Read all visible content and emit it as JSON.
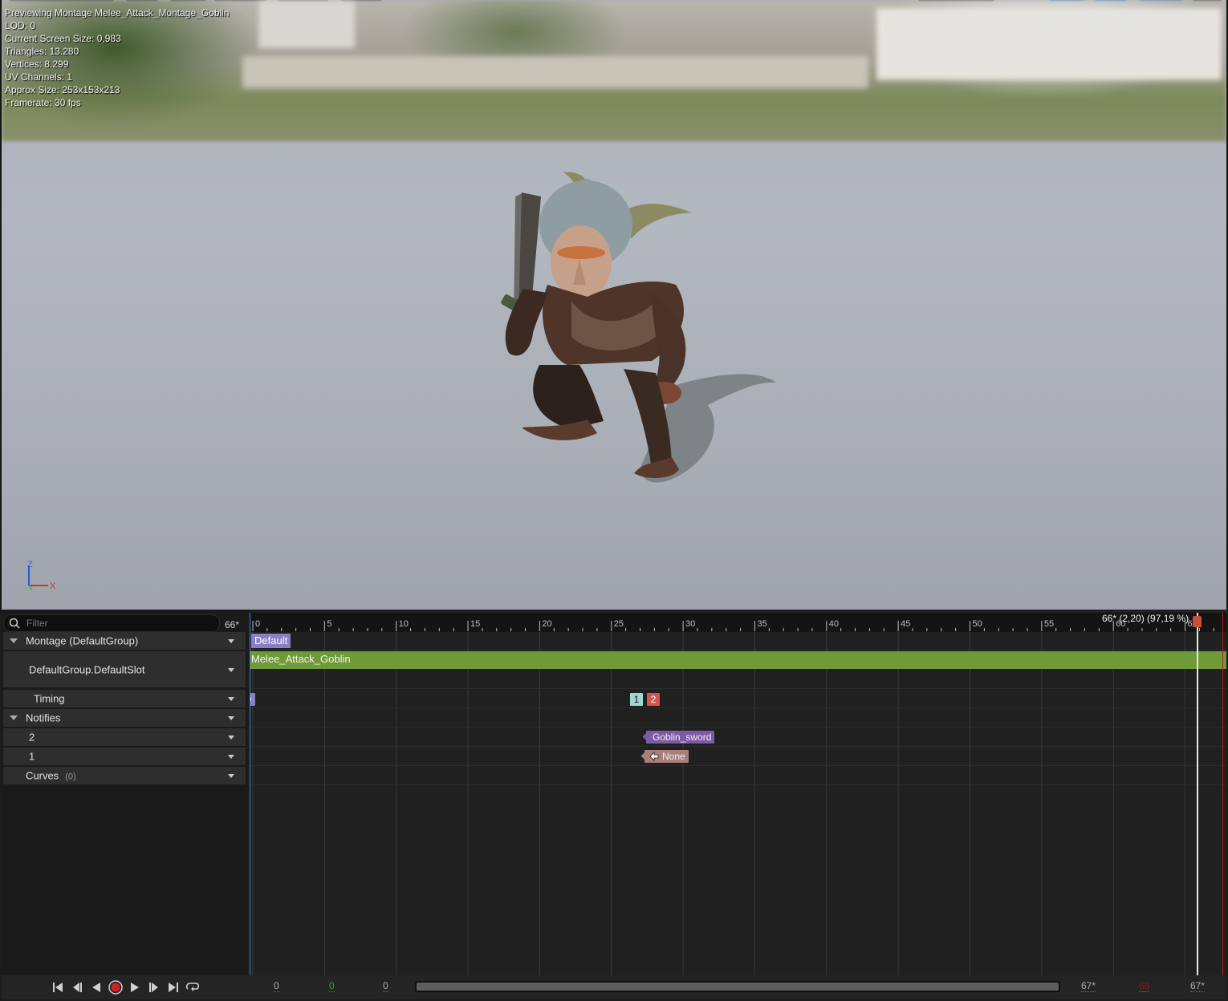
{
  "viewport": {
    "stats": [
      "Previewing Montage Melee_Attack_Montage_Goblin",
      "LOD: 0",
      "Current Screen Size: 0,983",
      "Triangles: 13.280",
      "Vertices: 8.299",
      "UV Channels: 1",
      "Approx Size: 253x153x213",
      "Framerate: 30 fps"
    ],
    "axis": {
      "z": "Z",
      "x": "X"
    }
  },
  "tree": {
    "filter_placeholder": "Filter",
    "frame_count": "66*",
    "rows": {
      "montage": "Montage (DefaultGroup)",
      "slot": "DefaultGroup.DefaultSlot",
      "timing": "Timing",
      "notifies": "Notifies",
      "notify_track_2": "2",
      "notify_track_1": "1",
      "curves": "Curves",
      "curves_count": "(0)"
    }
  },
  "timeline": {
    "ruler_labels": [
      "0",
      "5",
      "10",
      "15",
      "20",
      "25",
      "30",
      "35",
      "40",
      "45",
      "50",
      "55",
      "60",
      "65"
    ],
    "playhead_readout": "66* (2,20) (97,19 %)",
    "section_label": "Default",
    "segment_label": "Melee_Attack_Goblin",
    "timing_markers": [
      {
        "label": "1",
        "color": "#9fd6d2"
      },
      {
        "label": "2",
        "color": "#d9534f"
      }
    ],
    "start_marker_label": "0",
    "notifies": [
      {
        "track": "2",
        "label": "Goblin_sword",
        "color": "#7d5aa6"
      },
      {
        "track": "1",
        "label": "None",
        "color": "#a87f7a"
      }
    ]
  },
  "transport": {
    "buttons": [
      "to-start",
      "step-back",
      "play-reverse",
      "record",
      "play",
      "step-forward",
      "to-end",
      "loop"
    ],
    "range_start": "0",
    "range_current": "0",
    "range_offset": "0",
    "range_end": "67*",
    "range_end_red": "68",
    "range_total": "67*"
  },
  "colors": {
    "segment": "#6e9a38",
    "section": "#8a7ec4",
    "playhead_knob": "#c8503a",
    "record": "#d02020"
  }
}
